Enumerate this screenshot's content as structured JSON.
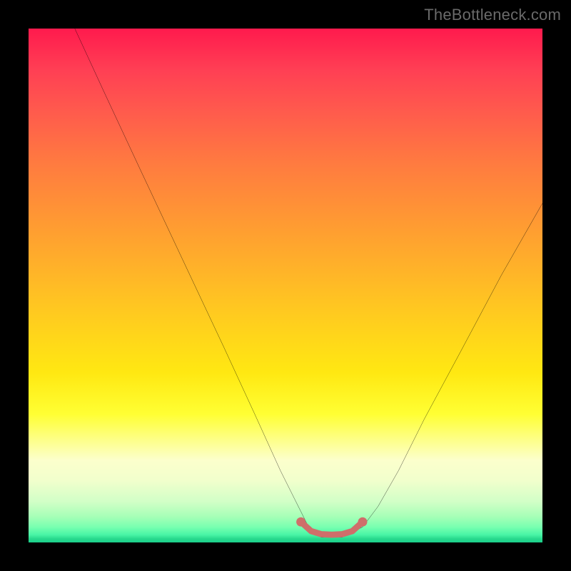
{
  "attribution": "TheBottleneck.com",
  "chart_data": {
    "type": "line",
    "title": "",
    "xlabel": "",
    "ylabel": "",
    "xlim": [
      0,
      100
    ],
    "ylim": [
      0,
      100
    ],
    "series": [
      {
        "name": "bottleneck-curve",
        "stroke": "#000000",
        "x": [
          9,
          15,
          22,
          30,
          38,
          44,
          49,
          53,
          55,
          57,
          59,
          61,
          63,
          65,
          68,
          72,
          77,
          84,
          92,
          100
        ],
        "y": [
          100,
          87,
          72,
          55,
          38,
          25,
          14,
          6,
          2,
          1,
          1,
          1,
          2,
          3,
          7,
          14,
          24,
          37,
          52,
          66
        ]
      },
      {
        "name": "optimal-band",
        "stroke": "#cf6e6a",
        "stroke_width": 8,
        "x": [
          53,
          55,
          57,
          59,
          61,
          63,
          65
        ],
        "y": [
          4.0,
          2.2,
          1.6,
          1.5,
          1.6,
          2.2,
          4.0
        ]
      }
    ],
    "markers": [
      {
        "name": "optimal-band-start",
        "x": 53,
        "y": 4.0,
        "color": "#cf6e6a",
        "r": 6
      },
      {
        "name": "optimal-band-end",
        "x": 65,
        "y": 4.0,
        "color": "#cf6e6a",
        "r": 6
      }
    ]
  },
  "colors": {
    "gradient_top": "#ff1a4d",
    "gradient_mid": "#ffe812",
    "gradient_bottom": "#1bcf8b",
    "curve": "#000000",
    "band": "#cf6e6a",
    "frame": "#000000",
    "attribution_text": "#6a6a6a"
  }
}
